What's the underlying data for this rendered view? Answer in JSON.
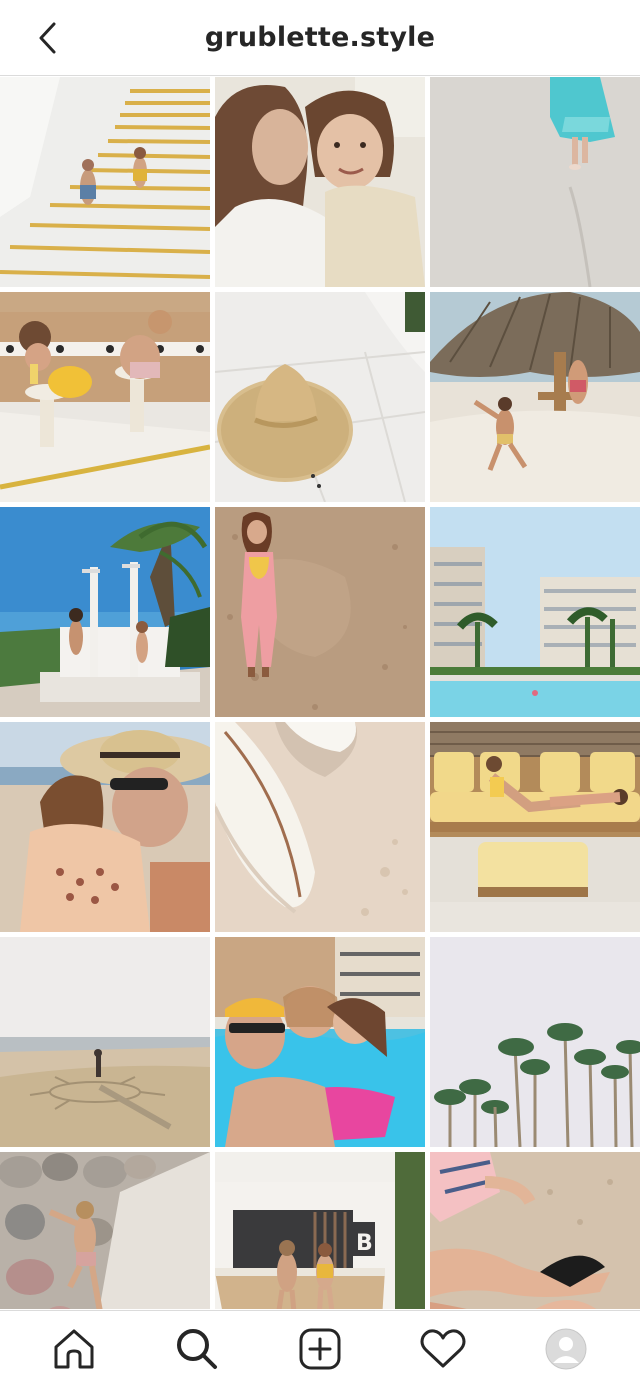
{
  "header": {
    "title": "grublette.style",
    "back_icon": "chevron-left-icon"
  },
  "grid": {
    "posts": [
      {
        "subject": "kids-on-stairs"
      },
      {
        "subject": "mother-daughter-selfie"
      },
      {
        "subject": "girl-on-beach-turquoise"
      },
      {
        "subject": "kids-at-juice-bar"
      },
      {
        "subject": "straw-hat"
      },
      {
        "subject": "palapa-beach-kids"
      },
      {
        "subject": "beach-shower"
      },
      {
        "subject": "girl-pink-romper"
      },
      {
        "subject": "resort-pool"
      },
      {
        "subject": "mother-hat-hug"
      },
      {
        "subject": "surfboards-sand"
      },
      {
        "subject": "kids-on-lounge"
      },
      {
        "subject": "sun-drawing-beach"
      },
      {
        "subject": "family-pool-selfie"
      },
      {
        "subject": "palm-trees-sky"
      },
      {
        "subject": "boy-climbing-rocks"
      },
      {
        "subject": "kids-at-bar-b"
      },
      {
        "subject": "feet-in-sand"
      }
    ]
  },
  "bottom_nav": {
    "items": [
      {
        "name": "home",
        "icon": "home-icon"
      },
      {
        "name": "search",
        "icon": "search-icon",
        "active": true
      },
      {
        "name": "new-post",
        "icon": "plus-square-icon"
      },
      {
        "name": "activity",
        "icon": "heart-icon"
      },
      {
        "name": "profile",
        "icon": "avatar-icon"
      }
    ]
  },
  "colors": {
    "text": "#262626",
    "border": "#dbdbdb",
    "background": "#ffffff"
  }
}
